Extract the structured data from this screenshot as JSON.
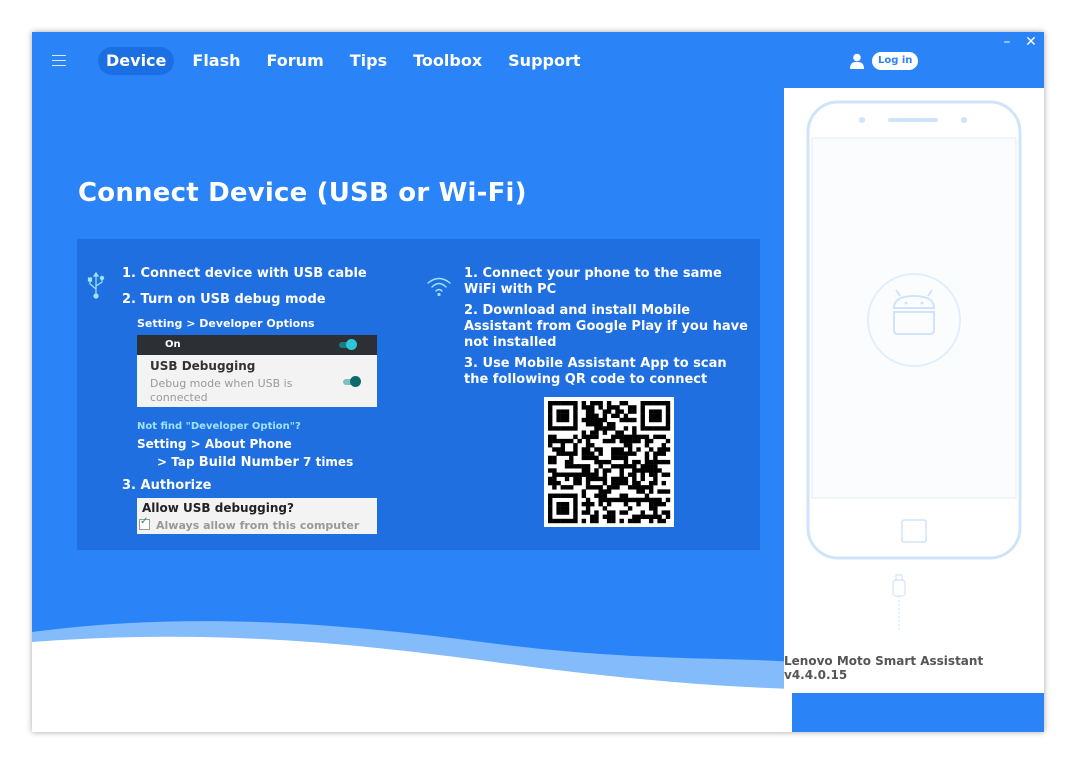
{
  "nav": {
    "tabs": [
      {
        "label": "Device",
        "active": true
      },
      {
        "label": "Flash"
      },
      {
        "label": "Forum"
      },
      {
        "label": "Tips"
      },
      {
        "label": "Toolbox"
      },
      {
        "label": "Support"
      }
    ],
    "login_label": "Log in"
  },
  "window_controls": {
    "minimize": "–",
    "close": "✕"
  },
  "page_title": "Connect Device (USB or Wi-Fi)",
  "usb": {
    "step1": "1. Connect device with USB cable",
    "step2": "2. Turn on USB debug mode",
    "path_label": "Setting > Developer Options",
    "on_label": "On",
    "usb_debugging_title": "USB Debugging",
    "usb_debugging_desc": "Debug mode when USB is connected",
    "not_find": "Not find \"Developer Option\"?",
    "about_phone": "Setting > About Phone",
    "tap_prefix": "> Tap ",
    "tap_bold": "Build Number",
    "tap_suffix": " 7 times",
    "step3": "3. Authorize",
    "allow_question": "Allow USB debugging?",
    "always_allow": "Always allow from this computer"
  },
  "wifi": {
    "step1": "1. Connect your phone to the same WiFi with PC",
    "step2": "2. Download and install Mobile Assistant from Google Play if you have not installed",
    "step3": "3. Use Mobile Assistant App to scan the following QR code to connect"
  },
  "footer": {
    "version": "Lenovo Moto Smart Assistant v4.4.0.15"
  },
  "colors": {
    "primary": "#2a83f7",
    "panel": "#1f6fe0",
    "accent_teal": "#2cc6d8"
  },
  "icons": [
    "menu-icon",
    "user-icon",
    "usb-icon",
    "wifi-icon",
    "android-icon",
    "usb-plug-icon"
  ]
}
